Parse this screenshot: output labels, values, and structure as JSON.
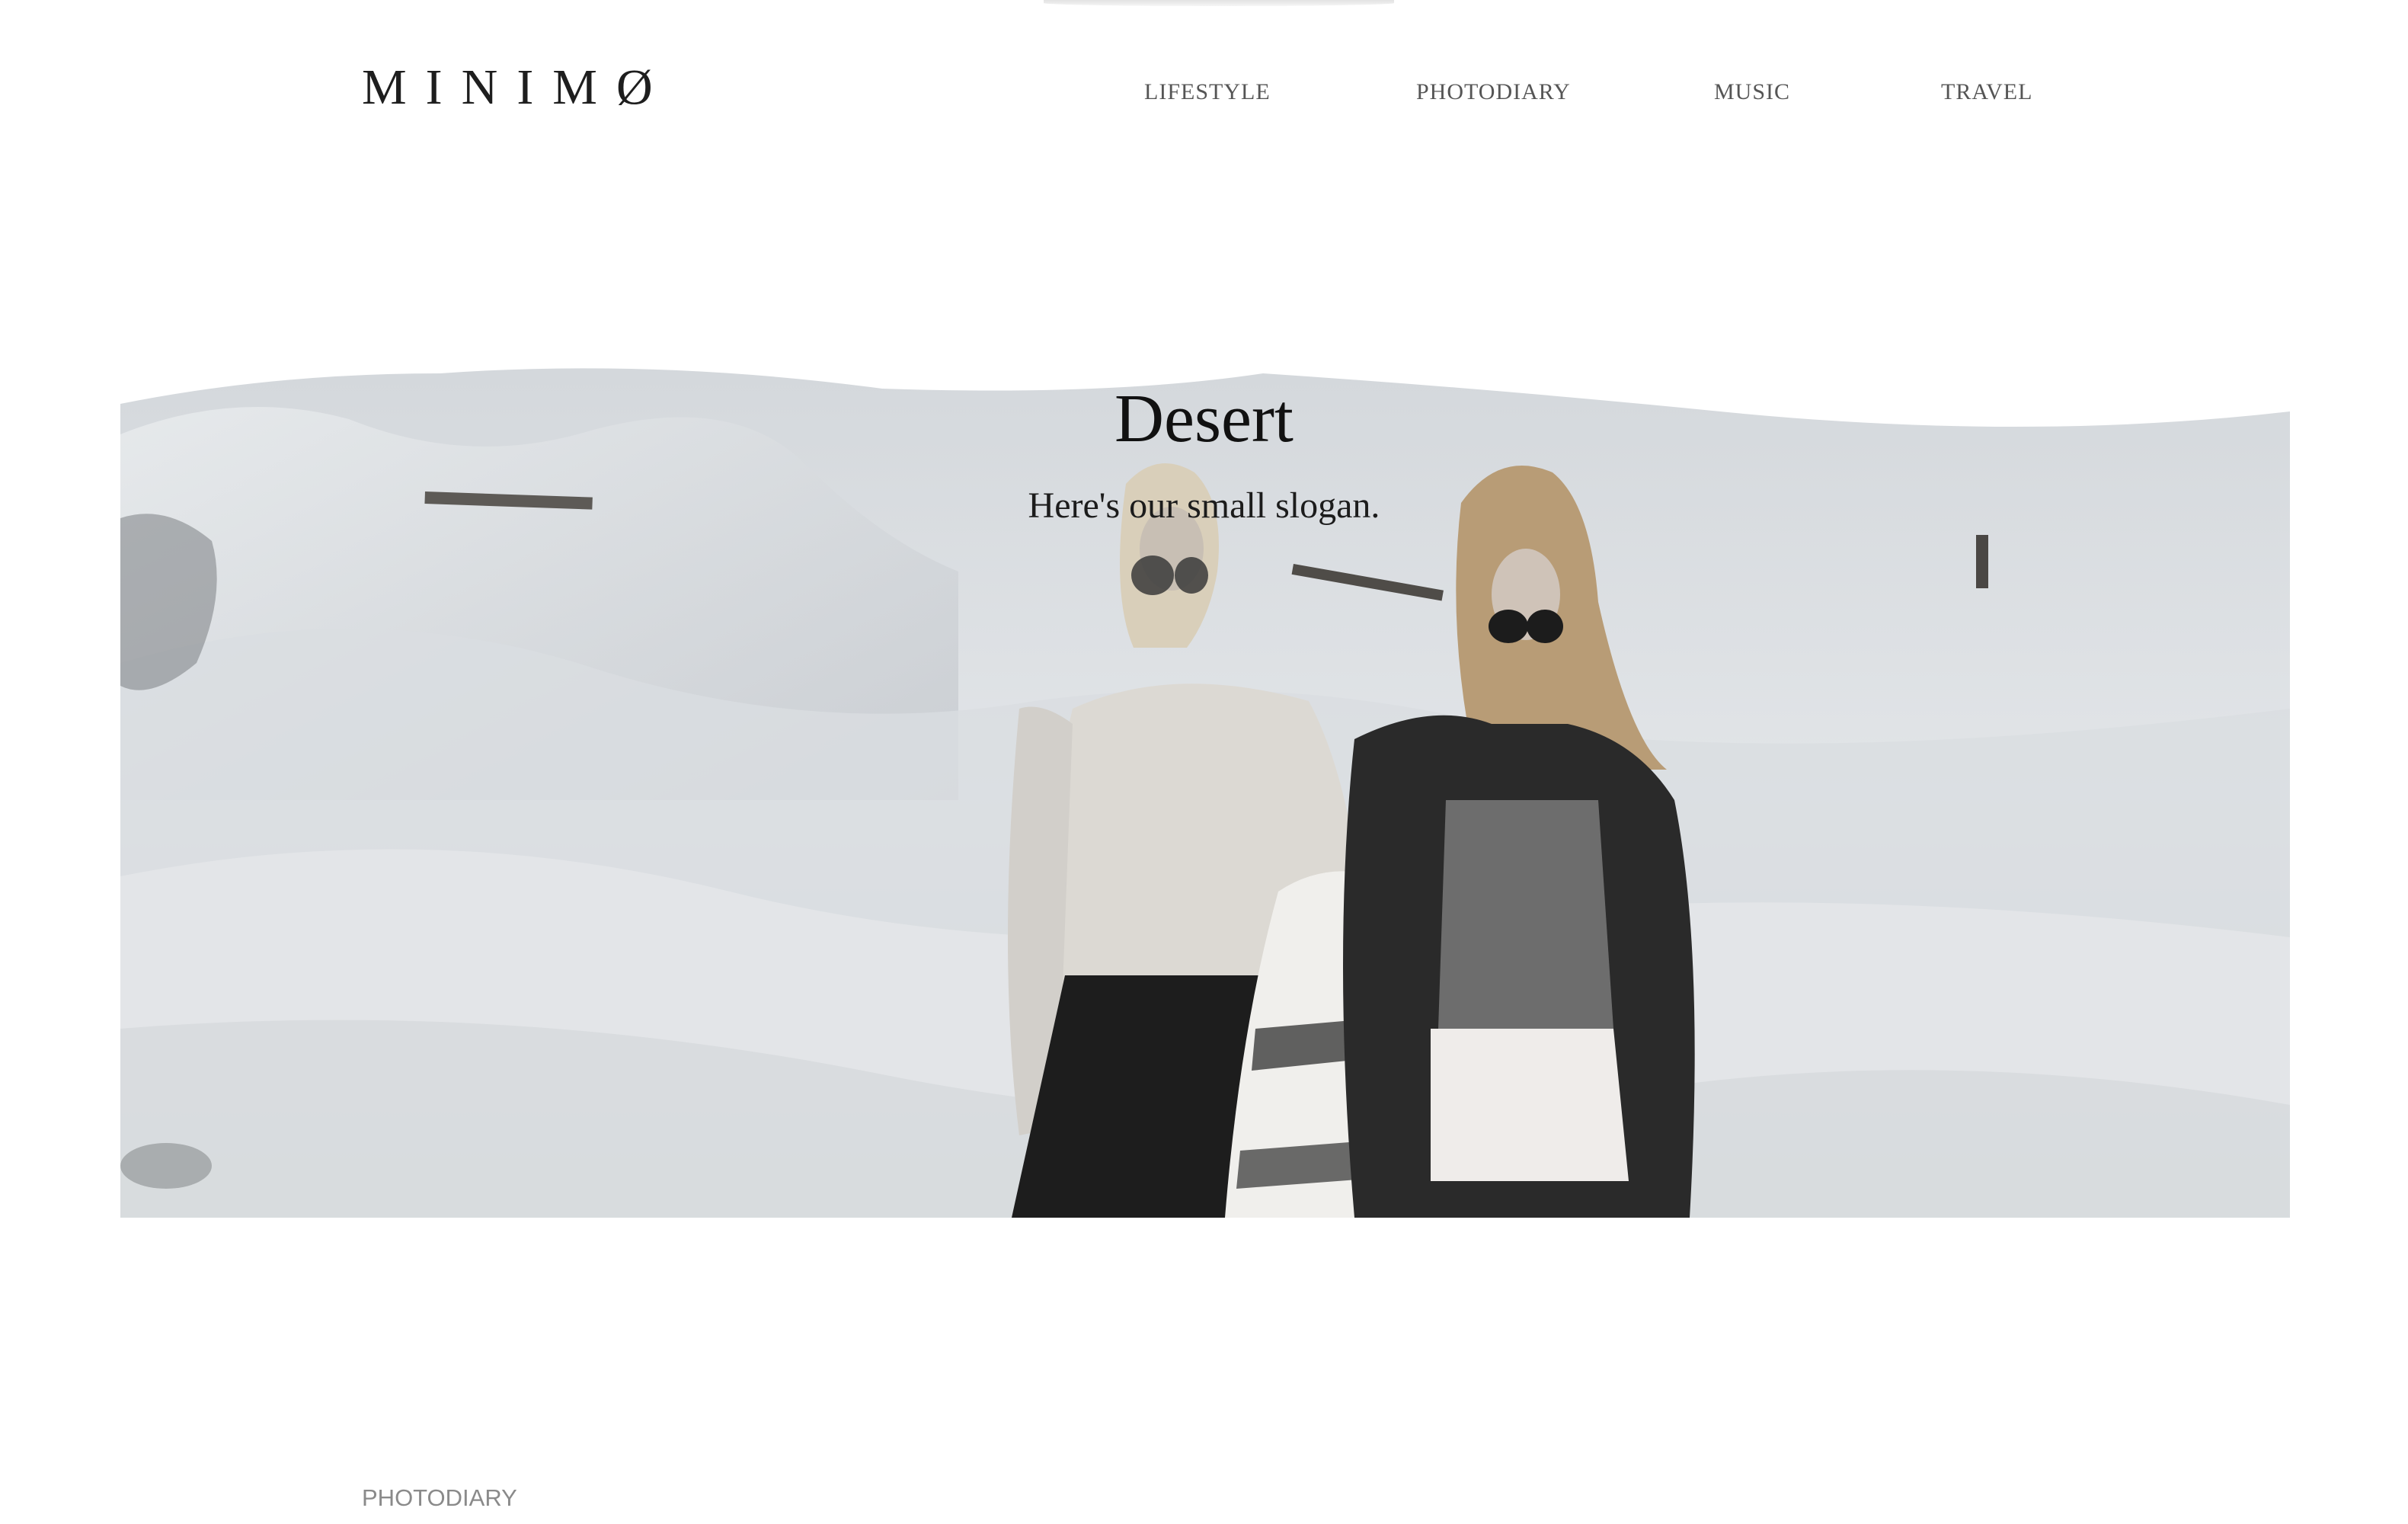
{
  "header": {
    "logo": "MINIMØ",
    "nav": [
      {
        "label": "LIFESTYLE"
      },
      {
        "label": "PHOTODIARY"
      },
      {
        "label": "MUSIC"
      },
      {
        "label": "TRAVEL"
      }
    ]
  },
  "hero": {
    "title": "Desert",
    "slogan": "Here's our small slogan.",
    "image": "desert-photo"
  },
  "section": {
    "label": "PHOTODIARY"
  }
}
